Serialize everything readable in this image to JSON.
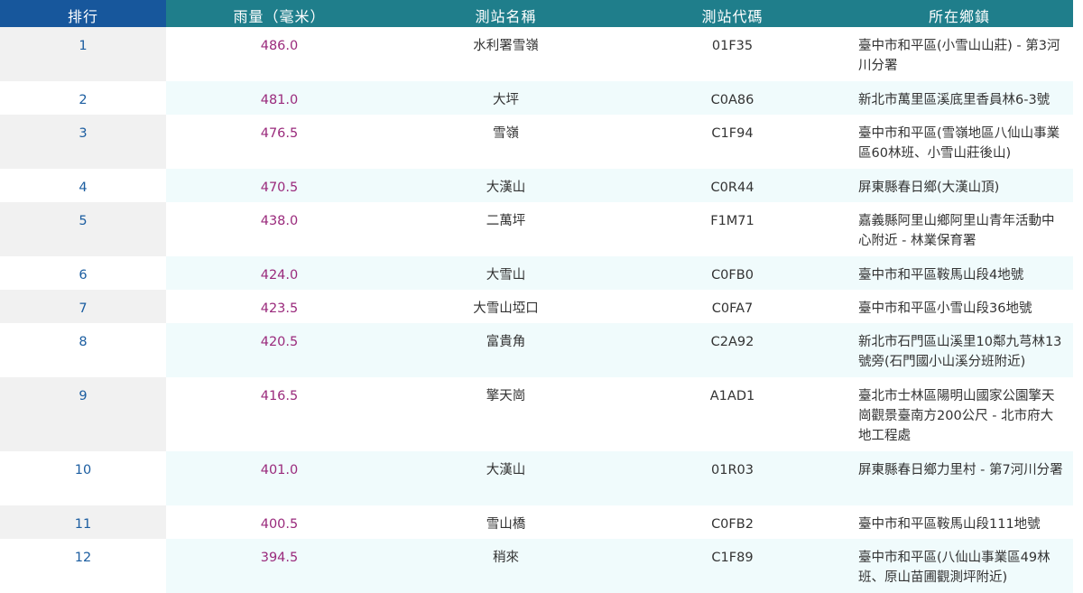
{
  "table": {
    "headers": {
      "rank": "排行",
      "rainfall": "雨量（毫米）",
      "station_name": "測站名稱",
      "station_code": "測站代碼",
      "location": "所在鄉鎮"
    },
    "rows": [
      {
        "rank": "1",
        "rainfall": "486.0",
        "name": "水利署雪嶺",
        "code": "01F35",
        "location": "臺中市和平區(小雪山山莊) - 第3河川分署"
      },
      {
        "rank": "2",
        "rainfall": "481.0",
        "name": "大坪",
        "code": "C0A86",
        "location": "新北市萬里區溪底里香員林6-3號"
      },
      {
        "rank": "3",
        "rainfall": "476.5",
        "name": "雪嶺",
        "code": "C1F94",
        "location": "臺中市和平區(雪嶺地區八仙山事業區60林班、小雪山莊後山)"
      },
      {
        "rank": "4",
        "rainfall": "470.5",
        "name": "大漢山",
        "code": "C0R44",
        "location": "屏東縣春日鄉(大漢山頂)"
      },
      {
        "rank": "5",
        "rainfall": "438.0",
        "name": "二萬坪",
        "code": "F1M71",
        "location": "嘉義縣阿里山鄉阿里山青年活動中心附近 - 林業保育署"
      },
      {
        "rank": "6",
        "rainfall": "424.0",
        "name": "大雪山",
        "code": "C0FB0",
        "location": "臺中市和平區鞍馬山段4地號"
      },
      {
        "rank": "7",
        "rainfall": "423.5",
        "name": "大雪山埡口",
        "code": "C0FA7",
        "location": "臺中市和平區小雪山段36地號"
      },
      {
        "rank": "8",
        "rainfall": "420.5",
        "name": "富貴角",
        "code": "C2A92",
        "location": "新北市石門區山溪里10鄰九芎林13號旁(石門國小山溪分班附近)"
      },
      {
        "rank": "9",
        "rainfall": "416.5",
        "name": "擎天崗",
        "code": "A1AD1",
        "location": "臺北市士林區陽明山國家公園擎天崗觀景臺南方200公尺 - 北市府大地工程處"
      },
      {
        "rank": "10",
        "rainfall": "401.0",
        "name": "大漢山",
        "code": "01R03",
        "location": "屏東縣春日鄉力里村 - 第7河川分署"
      },
      {
        "rank": "11",
        "rainfall": "400.5",
        "name": "雪山橋",
        "code": "C0FB2",
        "location": "臺中市和平區鞍馬山段111地號"
      },
      {
        "rank": "12",
        "rainfall": "394.5",
        "name": "稍來",
        "code": "C1F89",
        "location": "臺中市和平區(八仙山事業區49林班、原山苗圃觀測坪附近)"
      }
    ]
  }
}
